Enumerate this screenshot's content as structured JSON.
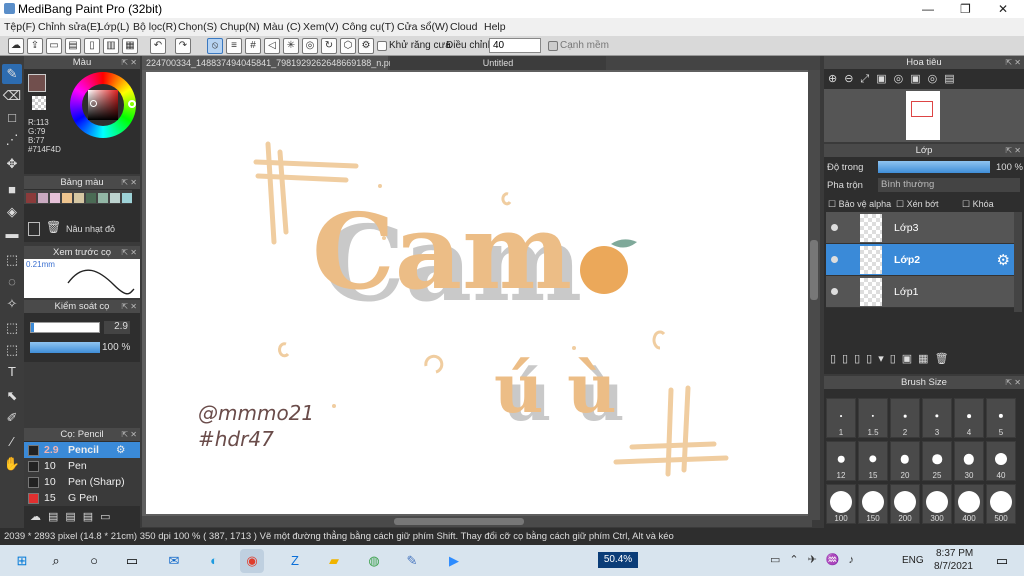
{
  "app": {
    "title": "MediBang Paint Pro (32bit)"
  },
  "menu": [
    "Tệp(F)",
    "Chỉnh sửa(E)",
    "Lớp(L)",
    "Bộ lọc(R)",
    "Chọn(S)",
    "Chụp(N)",
    "Màu (C)",
    "Xem(V)",
    "Công cụ(T)",
    "Cửa sổ(W)",
    "Cloud",
    "Help"
  ],
  "toolbar": {
    "antialias_label": "Khử răng cưa",
    "adjust_label": "Điều chỉnh",
    "adjust_value": "40",
    "edge_label": "Cạnh mềm"
  },
  "color_panel": {
    "title": "Màu",
    "r": "R:113",
    "g": "G:79",
    "b": "B:77",
    "hex": "#714F4D",
    "primary": "#714F4D"
  },
  "palette_panel": {
    "title": "Bảng màu",
    "selected_name": "Nâu nhạt đỏ",
    "swatches": [
      "#8a3b3b",
      "#c9a9c0",
      "#e6c1d8",
      "#efc58f",
      "#d6c7a3",
      "#4b6b55",
      "#93b7a6",
      "#bcd3cf",
      "#9ed3d8"
    ]
  },
  "preview_panel": {
    "title": "Xem trước cọ",
    "size": "0.21mm"
  },
  "brush_control": {
    "title": "Kiểm soát cọ",
    "size": "2.9",
    "opacity": "100 %"
  },
  "brush_list": {
    "title": "Cọ: Pencil",
    "items": [
      {
        "size": "2.9",
        "name": "Pencil",
        "color": "#333"
      },
      {
        "size": "10",
        "name": "Pen",
        "color": "#333"
      },
      {
        "size": "10",
        "name": "Pen (Sharp)",
        "color": "#333"
      },
      {
        "size": "15",
        "name": "G Pen",
        "color": "#e03030"
      }
    ]
  },
  "tabs": {
    "file": "224700334_148837494045841_7981929262648669188_n.png",
    "untitled": "Untitled"
  },
  "canvas": {
    "title_text": "Cam",
    "sub_text": "ú ù",
    "signature_line1": "@mmmo21",
    "signature_line2": "#hdr47"
  },
  "navigator": {
    "title": "Hoa tiêu"
  },
  "layer_panel": {
    "title": "Lớp",
    "opacity_label": "Độ trong",
    "opacity_value": "100 %",
    "blend_label": "Pha trộn",
    "blend_value": "Bình thường",
    "protect_alpha": "Bảo vệ alpha",
    "clip": "Xén bớt",
    "lock": "Khóa",
    "layers": [
      "Lớp3",
      "Lớp2",
      "Lớp1"
    ],
    "selected": "Lớp2"
  },
  "brush_size": {
    "title": "Brush Size",
    "sizes": [
      "1",
      "1.5",
      "2",
      "3",
      "4",
      "5",
      "12",
      "15",
      "20",
      "25",
      "30",
      "40",
      "100",
      "150",
      "200",
      "300",
      "400",
      "500"
    ]
  },
  "status": {
    "text": "2039 * 2893 pixel  (14.8 * 21cm)  350 dpi  100 %  ( 387, 1713 )  Vẽ một đường thẳng bằng cách giữ phím Shift. Thay đổi cỡ cọ bằng cách giữ phím Ctrl, Alt và kéo"
  },
  "taskbar": {
    "battery": "50.4%",
    "lang": "ENG",
    "time": "8:37 PM",
    "date": "8/7/2021"
  }
}
